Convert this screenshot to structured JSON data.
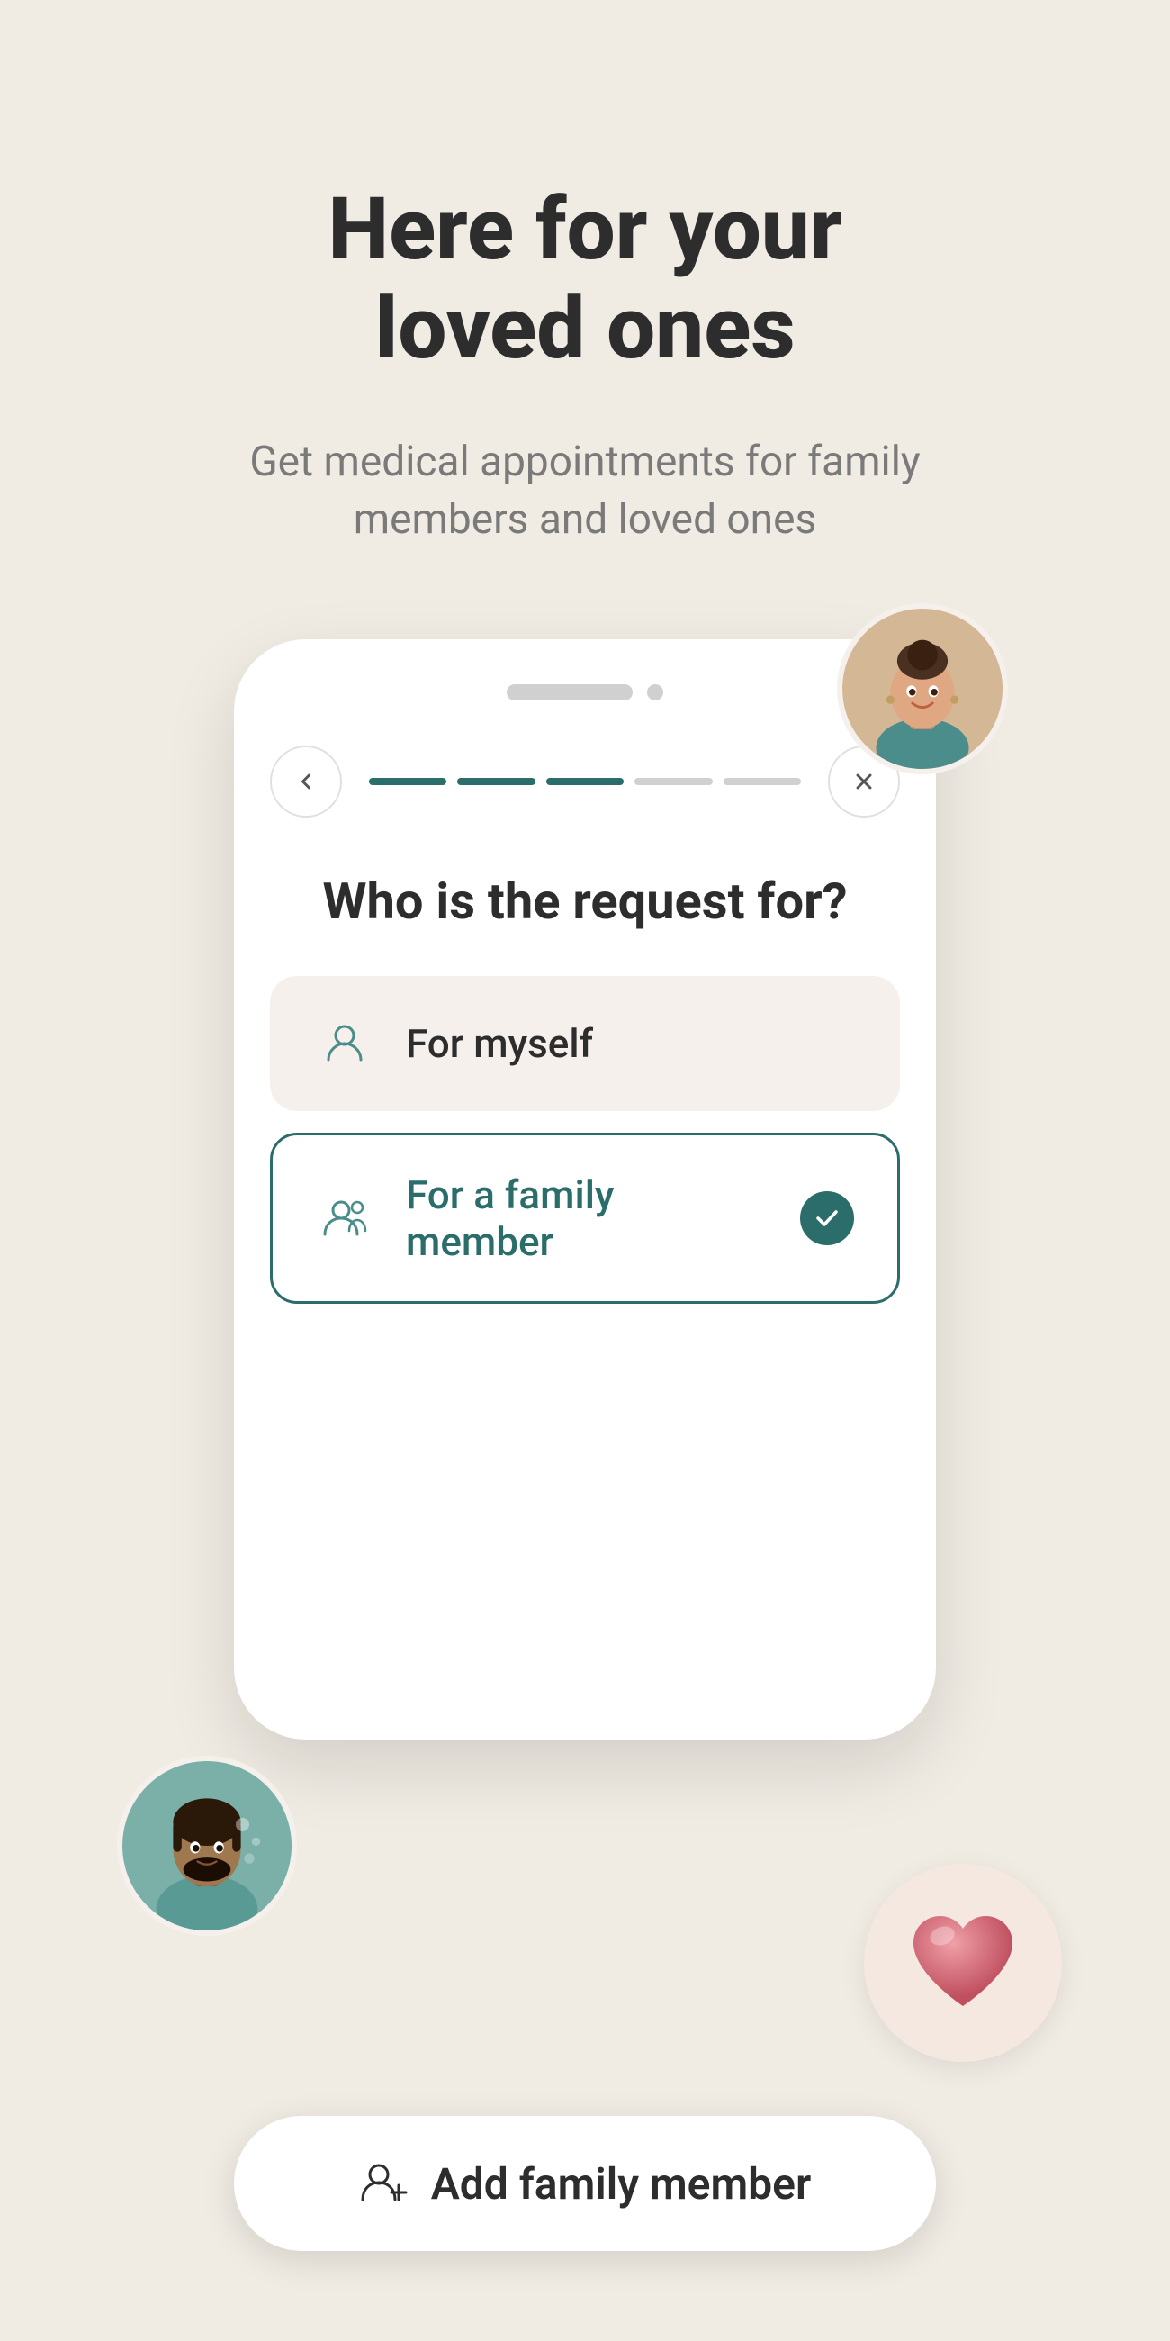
{
  "page": {
    "background_color": "#f0ebe3",
    "title": "Here for your\nloved ones",
    "subtitle": "Get medical appointments for family members and loved ones",
    "step_indicator": {
      "dots": [
        "bar",
        "circle"
      ]
    },
    "progress_bars": [
      {
        "state": "active"
      },
      {
        "state": "active"
      },
      {
        "state": "active"
      },
      {
        "state": "inactive"
      },
      {
        "state": "inactive"
      }
    ],
    "nav": {
      "back_label": "‹",
      "close_label": "×"
    },
    "question": "Who is the request for?",
    "options": [
      {
        "id": "myself",
        "label": "For myself",
        "selected": false
      },
      {
        "id": "family",
        "label": "For a family member",
        "selected": true
      }
    ],
    "bottom_button": {
      "label": "Add family member",
      "icon": "add-person-icon"
    }
  }
}
